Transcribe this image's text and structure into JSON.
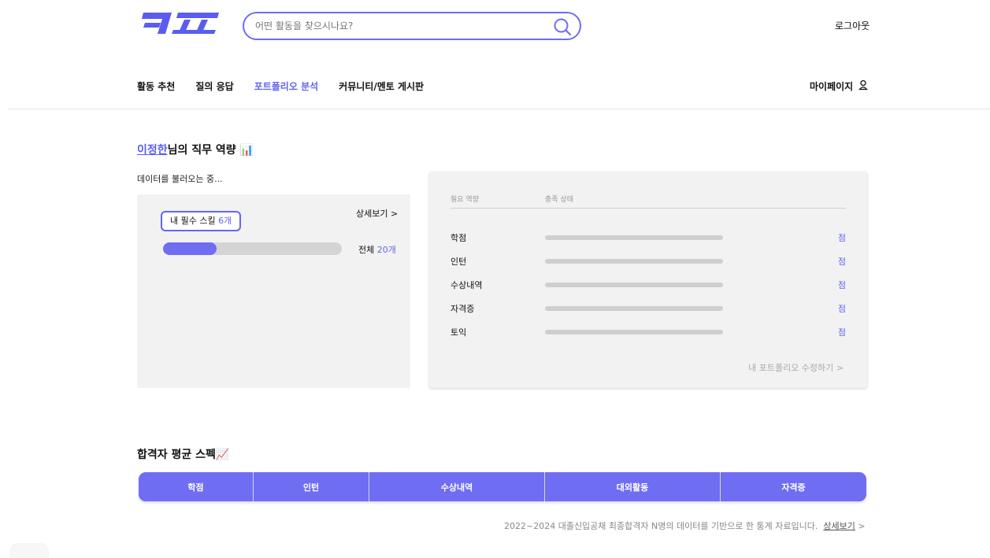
{
  "header": {
    "logo_text": "캐파",
    "search_placeholder": "어떤 활동을 찾으시나요?",
    "logout": "로그아웃",
    "nav": [
      "활동 추천",
      "질의 응답",
      "포트폴리오 분석",
      "커뮤니티/멘토 게시판"
    ],
    "nav_active_index": 2,
    "mypage": "마이페이지"
  },
  "competency": {
    "user_name": "이정한",
    "title_suffix": "님의 직무 역량 📊",
    "loading": "데이터를 불러오는 중...",
    "skill_label": "내 필수 스킬 ",
    "skill_count": "6개",
    "detail_link": "상세보기 >",
    "total_label": "전체 ",
    "total_count": "20개",
    "progress_fraction": 0.3
  },
  "requirements": {
    "col_required": "필요 역량",
    "col_status": "충족 상태",
    "rows": [
      {
        "label": "학점",
        "unit": "점"
      },
      {
        "label": "인턴",
        "unit": "점"
      },
      {
        "label": "수상내역",
        "unit": "점"
      },
      {
        "label": "자격증",
        "unit": "점"
      },
      {
        "label": "토익",
        "unit": "점"
      }
    ],
    "edit_link": "내 포트폴리오 수정하기 >"
  },
  "average": {
    "title": "합격자 평균 스펙📈",
    "columns": [
      "학점",
      "인턴",
      "수상내역",
      "대외활동",
      "자격증"
    ],
    "footnote": "2022~2024 대졸신입공채 최종합격자 N명의 데이터를 기반으로 한 통계 자료입니다.",
    "footnote_link": "상세보기",
    "footnote_arrow": ">"
  },
  "colors": {
    "accent": "#6f6df2",
    "accent_text": "#6366f1",
    "card_bg": "#f2f2f2"
  }
}
